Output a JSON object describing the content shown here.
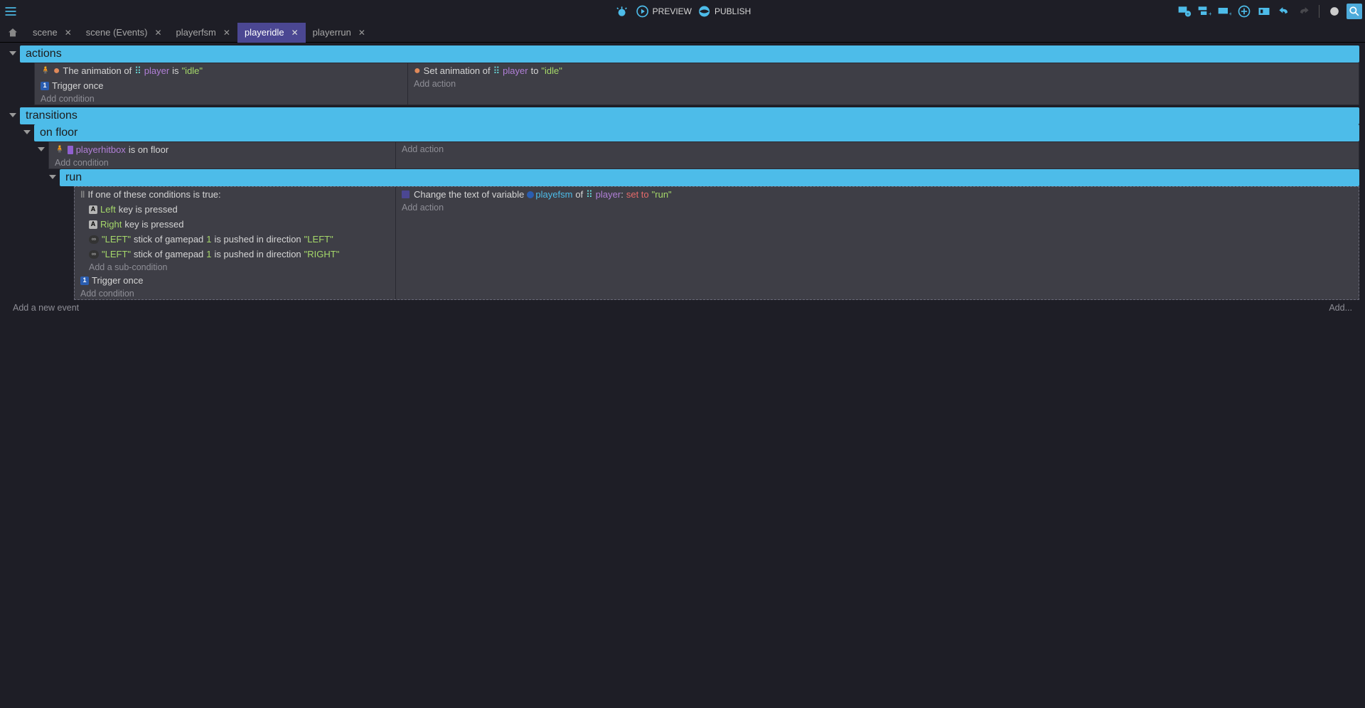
{
  "toolbar": {
    "preview_label": "PREVIEW",
    "publish_label": "PUBLISH"
  },
  "tabs": [
    {
      "label": "scene",
      "active": false
    },
    {
      "label": "scene (Events)",
      "active": false
    },
    {
      "label": "playerfsm",
      "active": false
    },
    {
      "label": "playeridle",
      "active": true
    },
    {
      "label": "playerrun",
      "active": false
    }
  ],
  "groups": {
    "actions": {
      "title": "actions",
      "cond_anim_prefix": "The animation of",
      "cond_anim_obj": "player",
      "cond_anim_mid": "is",
      "cond_anim_val": "\"idle\"",
      "trigger_once": "Trigger once",
      "add_condition": "Add condition",
      "act_anim_prefix": "Set animation of",
      "act_anim_obj": "player",
      "act_anim_mid": "to",
      "act_anim_val": "\"idle\"",
      "add_action": "Add action"
    },
    "transitions": {
      "title": "transitions"
    },
    "on_floor": {
      "title": "on floor",
      "cond_obj": "playerhitbox",
      "cond_suffix": "is on floor",
      "add_condition": "Add condition",
      "add_action": "Add action"
    },
    "run": {
      "title": "run",
      "or_prefix": "If one of these conditions is true:",
      "left_key": "Left",
      "right_key": "Right",
      "key_pressed": "key is pressed",
      "stick_left1": "\"LEFT\"",
      "stick_mid": "stick of gamepad",
      "stick_num": "1",
      "stick_dir": "is pushed in direction",
      "stick_dir_left": "\"LEFT\"",
      "stick_dir_right": "\"RIGHT\"",
      "add_subcond": "Add a sub-condition",
      "trigger_once": "Trigger once",
      "add_condition": "Add condition",
      "act_prefix": "Change the text of variable",
      "act_var": "playefsm",
      "act_of": "of",
      "act_obj": "player",
      "act_setto": "set to",
      "act_val": "\"run\"",
      "add_action": "Add action"
    }
  },
  "footer": {
    "add_new_event": "Add a new event",
    "add_more": "Add..."
  }
}
